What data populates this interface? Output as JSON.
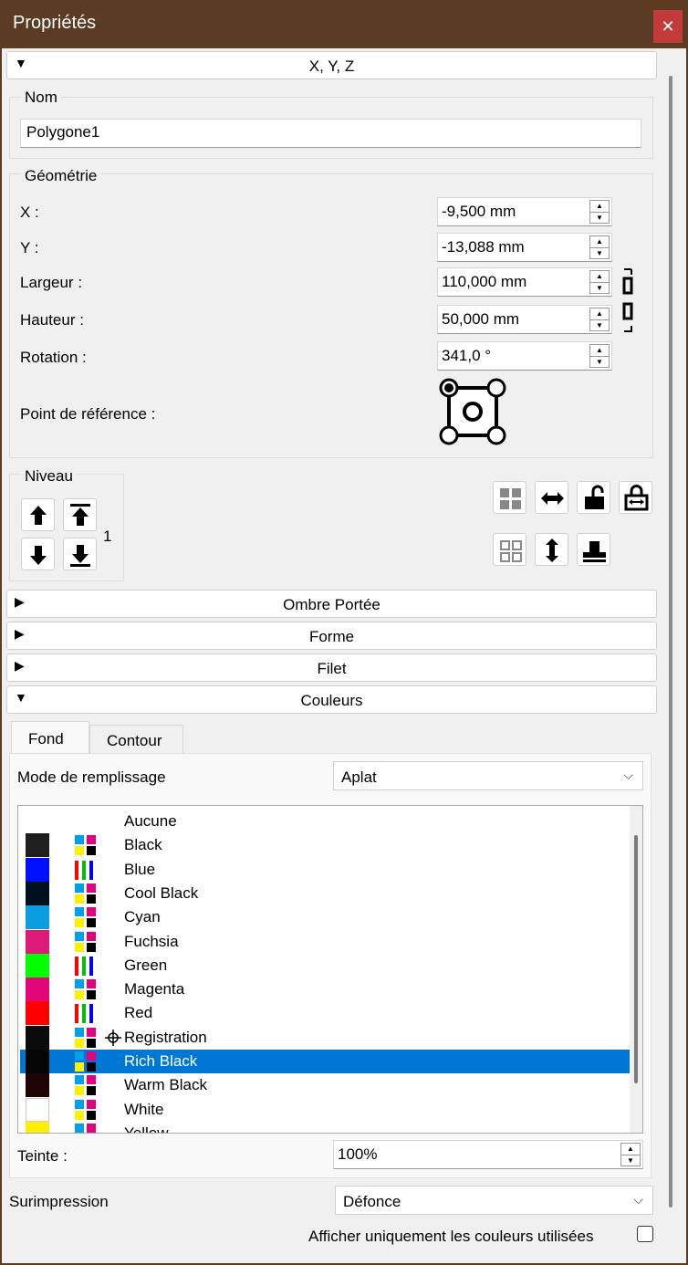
{
  "window": {
    "title": "Propriétés",
    "close_label": "✕"
  },
  "sections": {
    "xyz": "X, Y, Z",
    "shadow": "Ombre Portée",
    "shape": "Forme",
    "line": "Filet",
    "colors": "Couleurs"
  },
  "name_group": {
    "label": "Nom",
    "value": "Polygone1"
  },
  "geometry": {
    "label": "Géométrie",
    "x": {
      "label": "X :",
      "value": "-9,500 mm"
    },
    "y": {
      "label": "Y :",
      "value": "-13,088 mm"
    },
    "width": {
      "label": "Largeur :",
      "value": "110,000 mm"
    },
    "height": {
      "label": "Hauteur :",
      "value": "50,000 mm"
    },
    "rotation": {
      "label": "Rotation :",
      "value": "341,0 °"
    },
    "refpoint": {
      "label": "Point de référence :"
    }
  },
  "level": {
    "label": "Niveau",
    "value": "1"
  },
  "colors": {
    "tabs": [
      "Fond",
      "Contour"
    ],
    "active_tab": "Fond",
    "fill_mode": {
      "label": "Mode de remplissage",
      "value": "Aplat"
    },
    "list": [
      {
        "name": "Aucune",
        "swatch": null,
        "model": null
      },
      {
        "name": "Black",
        "swatch": "#1e1e1e",
        "model": "cmyk"
      },
      {
        "name": "Blue",
        "swatch": "#0010ff",
        "model": "rgb"
      },
      {
        "name": "Cool Black",
        "swatch": "#00101e",
        "model": "cmyk"
      },
      {
        "name": "Cyan",
        "swatch": "#0a9ee0",
        "model": "cmyk"
      },
      {
        "name": "Fuchsia",
        "swatch": "#dd1a7a",
        "model": "cmyk"
      },
      {
        "name": "Green",
        "swatch": "#00ff00",
        "model": "rgb"
      },
      {
        "name": "Magenta",
        "swatch": "#e2087a",
        "model": "cmyk"
      },
      {
        "name": "Red",
        "swatch": "#ff0000",
        "model": "rgb"
      },
      {
        "name": "Registration",
        "swatch": "#0a0a0a",
        "model": "cmyk",
        "registration": true
      },
      {
        "name": "Rich Black",
        "swatch": "#050505",
        "model": "cmyk",
        "selected": true
      },
      {
        "name": "Warm Black",
        "swatch": "#1e0606",
        "model": "cmyk"
      },
      {
        "name": "White",
        "swatch": "#ffffff",
        "model": "cmyk"
      },
      {
        "name": "Yellow",
        "swatch": "#ffee00",
        "model": "cmyk"
      }
    ],
    "tint": {
      "label": "Teinte :",
      "value": "100%"
    }
  },
  "overprint": {
    "label": "Surimpression",
    "value": "Défonce"
  },
  "show_used": {
    "label": "Afficher uniquement les couleurs utilisées",
    "checked": false
  }
}
